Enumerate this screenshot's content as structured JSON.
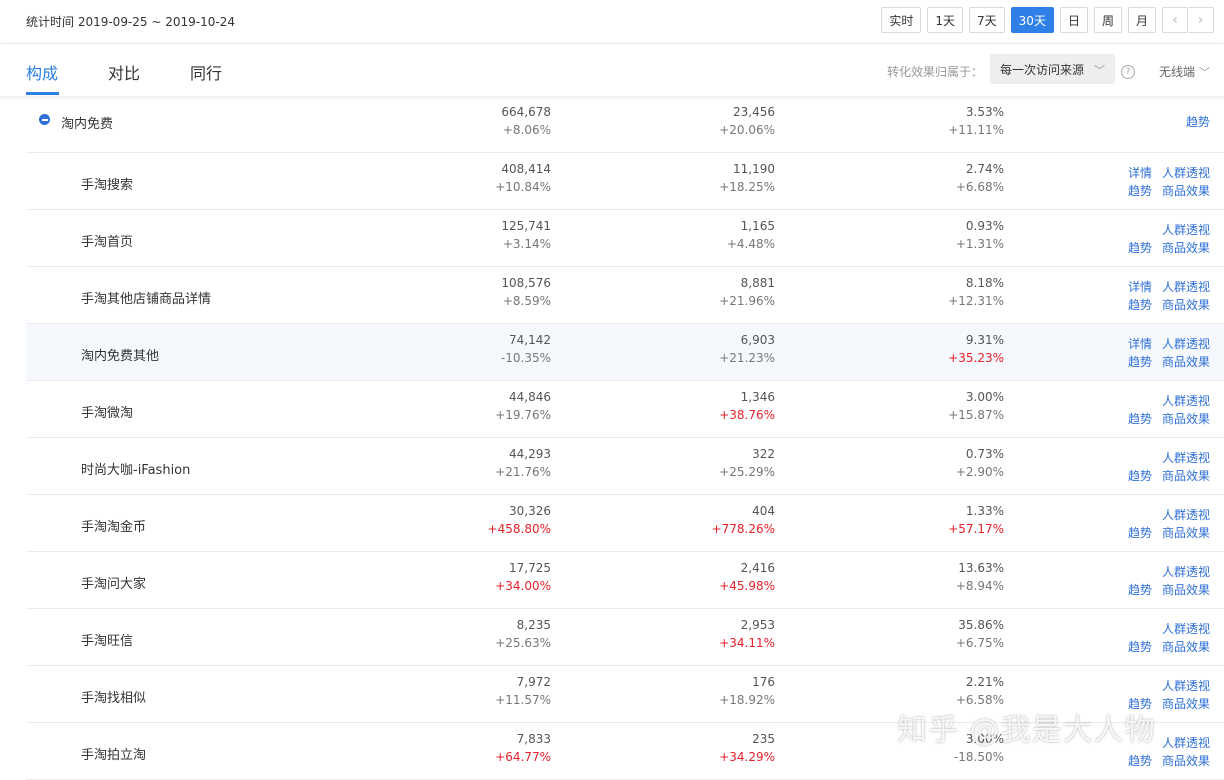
{
  "header": {
    "stat_time": "统计时间 2019-09-25 ~ 2019-10-24",
    "periods": [
      "实时",
      "1天",
      "7天",
      "30天",
      "日",
      "周",
      "月"
    ],
    "active_period": "30天",
    "prev_icon": "chevron-left-icon",
    "next_icon": "chevron-right-icon"
  },
  "tabs": {
    "items": [
      "构成",
      "对比",
      "同行"
    ],
    "active": "构成"
  },
  "attribution": {
    "label": "转化效果归属于：",
    "selected": "每一次访问来源",
    "help_icon": "question-icon",
    "device": "无线端"
  },
  "colors": {
    "accent": "#2f80e6",
    "link": "#2f6fd8",
    "negative_highlight": "#e8222a"
  },
  "group": {
    "name": "淘内免费",
    "v1": "664,678",
    "c1": "+8.06%",
    "v2": "23,456",
    "c2": "+20.06%",
    "v3": "3.53%",
    "c3": "+11.11%",
    "trend": "趋势"
  },
  "action_labels": {
    "detail": "详情",
    "crowd": "人群透视",
    "trend": "趋势",
    "product": "商品效果"
  },
  "rows": [
    {
      "name": "手淘搜索",
      "v1": "408,414",
      "c1": "+10.84%",
      "v2": "11,190",
      "c2": "+18.25%",
      "v3": "2.74%",
      "c3": "+6.68%",
      "detail": true
    },
    {
      "name": "手淘首页",
      "v1": "125,741",
      "c1": "+3.14%",
      "v2": "1,165",
      "c2": "+4.48%",
      "v3": "0.93%",
      "c3": "+1.31%",
      "detail": false
    },
    {
      "name": "手淘其他店铺商品详情",
      "v1": "108,576",
      "c1": "+8.59%",
      "v2": "8,881",
      "c2": "+21.96%",
      "v3": "8.18%",
      "c3": "+12.31%",
      "detail": true
    },
    {
      "name": "淘内免费其他",
      "v1": "74,142",
      "c1": "-10.35%",
      "v2": "6,903",
      "c2": "+21.23%",
      "v3": "9.31%",
      "c3": "+35.23%",
      "c3_red": true,
      "detail": true,
      "highlight": true
    },
    {
      "name": "手淘微淘",
      "v1": "44,846",
      "c1": "+19.76%",
      "v2": "1,346",
      "c2": "+38.76%",
      "c2_red": true,
      "v3": "3.00%",
      "c3": "+15.87%",
      "detail": false
    },
    {
      "name": "时尚大咖-iFashion",
      "v1": "44,293",
      "c1": "+21.76%",
      "v2": "322",
      "c2": "+25.29%",
      "v3": "0.73%",
      "c3": "+2.90%",
      "detail": false
    },
    {
      "name": "手淘淘金币",
      "v1": "30,326",
      "c1": "+458.80%",
      "c1_red": true,
      "v2": "404",
      "c2": "+778.26%",
      "c2_red": true,
      "v3": "1.33%",
      "c3": "+57.17%",
      "c3_red": true,
      "detail": false
    },
    {
      "name": "手淘问大家",
      "v1": "17,725",
      "c1": "+34.00%",
      "c1_red": true,
      "v2": "2,416",
      "c2": "+45.98%",
      "c2_red": true,
      "v3": "13.63%",
      "c3": "+8.94%",
      "detail": false
    },
    {
      "name": "手淘旺信",
      "v1": "8,235",
      "c1": "+25.63%",
      "v2": "2,953",
      "c2": "+34.11%",
      "c2_red": true,
      "v3": "35.86%",
      "c3": "+6.75%",
      "detail": false
    },
    {
      "name": "手淘找相似",
      "v1": "7,972",
      "c1": "+11.57%",
      "v2": "176",
      "c2": "+18.92%",
      "v3": "2.21%",
      "c3": "+6.58%",
      "detail": false
    },
    {
      "name": "手淘拍立淘",
      "v1": "7,833",
      "c1": "+64.77%",
      "c1_red": true,
      "v2": "235",
      "c2": "+34.29%",
      "c2_red": true,
      "v3": "3.00%",
      "c3": "-18.50%",
      "detail": false
    }
  ],
  "watermark": "知乎 @我是大人物"
}
